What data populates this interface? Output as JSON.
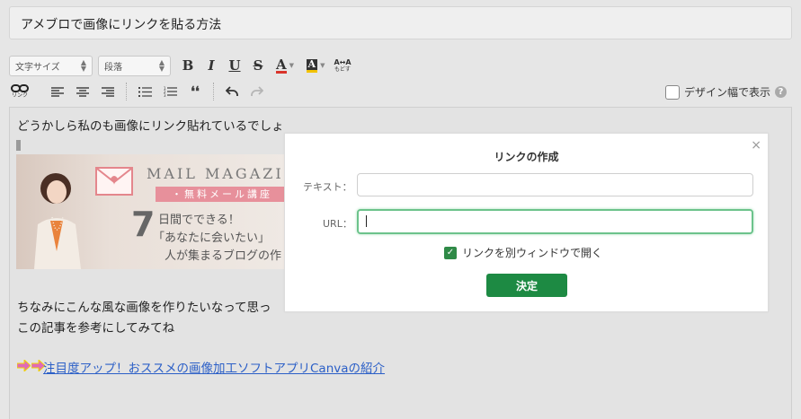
{
  "editor": {
    "title": "アメブロで画像にリンクを貼る方法",
    "body": {
      "line1": "どうかしら私のも画像にリンク貼れているでしょ",
      "line2": "ちなみにこんな風な画像を作りたいなって思っ",
      "line3": "この記事を参考にしてみてね",
      "link_text": "注目度アップ！おススメの画像加工ソフトアプリCanvaの紹介"
    },
    "banner": {
      "heading": "MAIL MAGAZI",
      "ribbon": "・無料メール講座",
      "number": "7",
      "line1": "日間でできる！",
      "line2": "「あなたに会いたい」",
      "line3": "人が集まるブログの作"
    }
  },
  "toolbar": {
    "font_size_select": "文字サイズ",
    "paragraph_select": "段落",
    "bold": "B",
    "italic": "I",
    "underline": "U",
    "strike": "S",
    "text_color": "A",
    "bg_color": "A",
    "reset_label_top": "A↔A",
    "reset_label_bottom": "もどす",
    "link_label": "リンク",
    "quote": "❛❛",
    "design_width_label": "デザイン幅で表示",
    "help": "?"
  },
  "dialog": {
    "title": "リンクの作成",
    "close": "×",
    "text_label": "テキスト：",
    "text_value": "",
    "url_label": "URL：",
    "url_value": "",
    "new_window_label": "リンクを別ウィンドウで開く",
    "new_window_checked": true,
    "submit_label": "決定"
  },
  "colors": {
    "accent_green": "#1d8a43",
    "focus_green": "#6cc38b",
    "link_blue": "#2b5fc7",
    "text_color_red": "#d9342b",
    "bg_color_yellow": "#f2c200"
  }
}
